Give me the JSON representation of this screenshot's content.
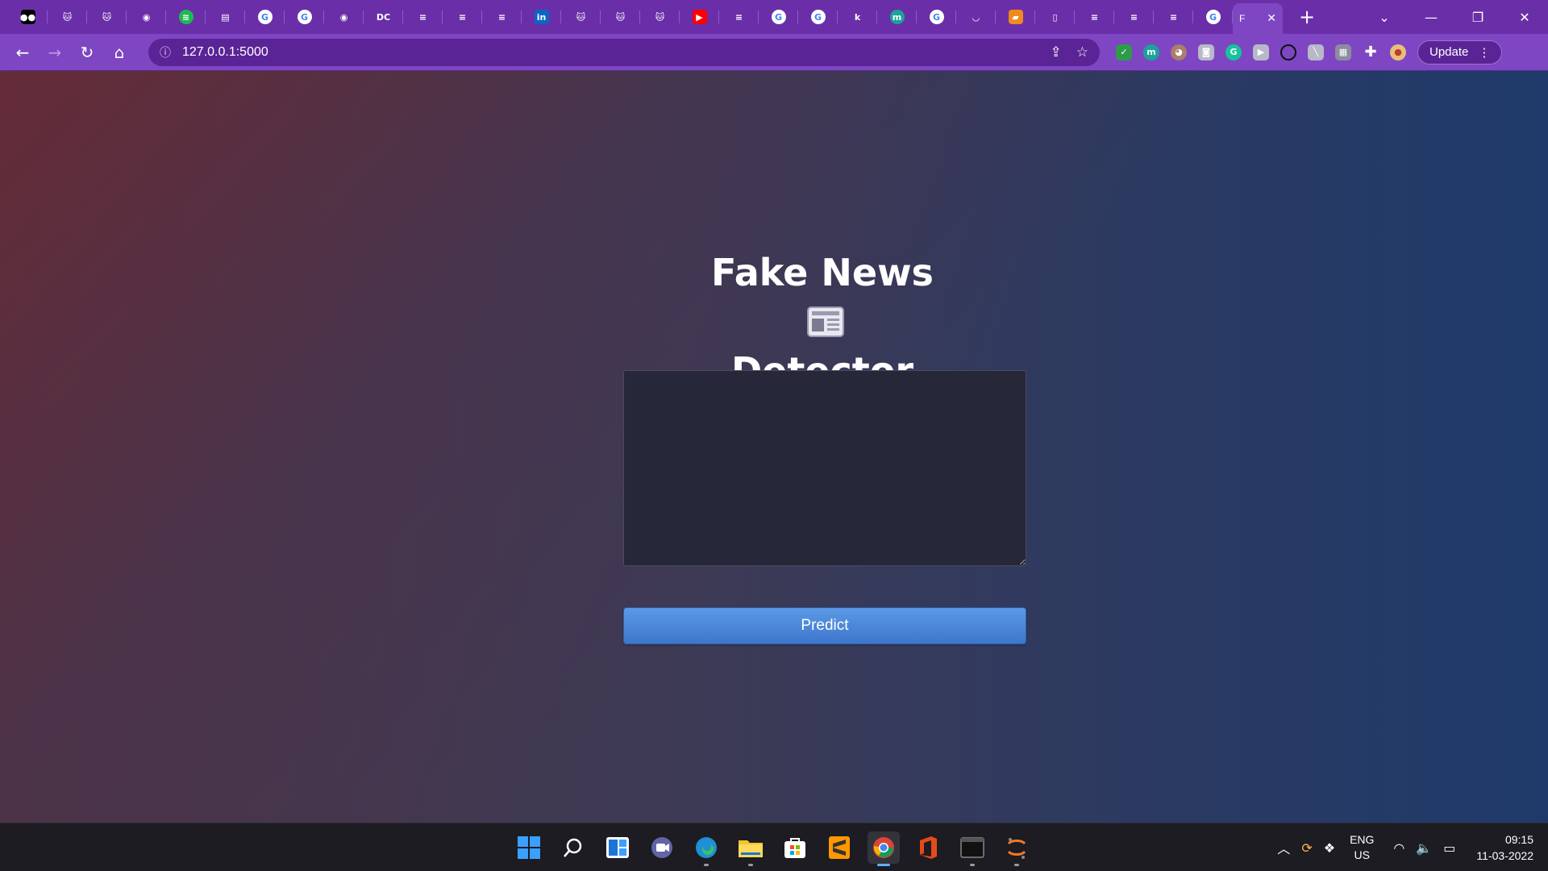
{
  "browser": {
    "tabs": [
      {
        "icon": "medium-icon",
        "glyph": "●●",
        "bg": "#000000"
      },
      {
        "icon": "kaggle-cat-icon",
        "glyph": "🐱",
        "bg": "#6a2fa8"
      },
      {
        "icon": "kaggle-cat-icon",
        "glyph": "🐱",
        "bg": "#6a2fa8"
      },
      {
        "icon": "github-icon",
        "glyph": "◉",
        "bg": "#6a2fa8"
      },
      {
        "icon": "spotify-icon",
        "glyph": "≋",
        "bg": "#1db954"
      },
      {
        "icon": "sheets-icon",
        "glyph": "▤",
        "bg": "#6a2fa8"
      },
      {
        "icon": "google-icon",
        "glyph": "G",
        "bg": "#ffffff"
      },
      {
        "icon": "google-icon",
        "glyph": "G",
        "bg": "#ffffff"
      },
      {
        "icon": "github-icon",
        "glyph": "◉",
        "bg": "#6a2fa8"
      },
      {
        "icon": "datacamp-icon",
        "glyph": "DC",
        "bg": "#6a2fa8"
      },
      {
        "icon": "stackoverflow-icon",
        "glyph": "≡",
        "bg": "#6a2fa8"
      },
      {
        "icon": "stackoverflow-icon",
        "glyph": "≡",
        "bg": "#6a2fa8"
      },
      {
        "icon": "stackoverflow-icon",
        "glyph": "≡",
        "bg": "#6a2fa8"
      },
      {
        "icon": "linkedin-icon",
        "glyph": "in",
        "bg": "#0a66c2"
      },
      {
        "icon": "kaggle-cat-icon",
        "glyph": "🐱",
        "bg": "#6a2fa8"
      },
      {
        "icon": "kaggle-cat-icon",
        "glyph": "🐱",
        "bg": "#6a2fa8"
      },
      {
        "icon": "kaggle-cat-icon",
        "glyph": "🐱",
        "bg": "#6a2fa8"
      },
      {
        "icon": "youtube-icon",
        "glyph": "▶",
        "bg": "#ff0000"
      },
      {
        "icon": "stackoverflow-icon",
        "glyph": "≡",
        "bg": "#6a2fa8"
      },
      {
        "icon": "google-icon",
        "glyph": "G",
        "bg": "#ffffff"
      },
      {
        "icon": "google-icon",
        "glyph": "G",
        "bg": "#ffffff"
      },
      {
        "icon": "kaggle-k-icon",
        "glyph": "k",
        "bg": "#6a2fa8"
      },
      {
        "icon": "m-circle-icon",
        "glyph": "m",
        "bg": "#1aa39a"
      },
      {
        "icon": "google-icon",
        "glyph": "G",
        "bg": "#ffffff"
      },
      {
        "icon": "jupyter-icon",
        "glyph": "◡",
        "bg": "#6a2fa8"
      },
      {
        "icon": "eraser-icon",
        "glyph": "▰",
        "bg": "#f08a1c"
      },
      {
        "icon": "document-icon",
        "glyph": "▯",
        "bg": "#6a2fa8"
      },
      {
        "icon": "stackoverflow-icon",
        "glyph": "≡",
        "bg": "#6a2fa8"
      },
      {
        "icon": "stackoverflow-icon",
        "glyph": "≡",
        "bg": "#6a2fa8"
      },
      {
        "icon": "stackoverflow-icon",
        "glyph": "≡",
        "bg": "#6a2fa8"
      },
      {
        "icon": "google-icon",
        "glyph": "G",
        "bg": "#ffffff"
      }
    ],
    "active_tab": {
      "title": "F"
    },
    "address": "127.0.0.1:5000",
    "update_label": "Update"
  },
  "page": {
    "title_line1": "Fake News",
    "title_line2": "Detector",
    "textarea_value": "",
    "predict_label": "Predict"
  },
  "taskbar": {
    "lang_line1": "ENG",
    "lang_line2": "US",
    "time": "09:15",
    "date": "11-03-2022"
  },
  "colors": {
    "tab_strip": "#6a2fa8",
    "toolbar": "#7e46c2",
    "button_blue": "#4a86d8",
    "taskbar": "#1c1c22"
  }
}
